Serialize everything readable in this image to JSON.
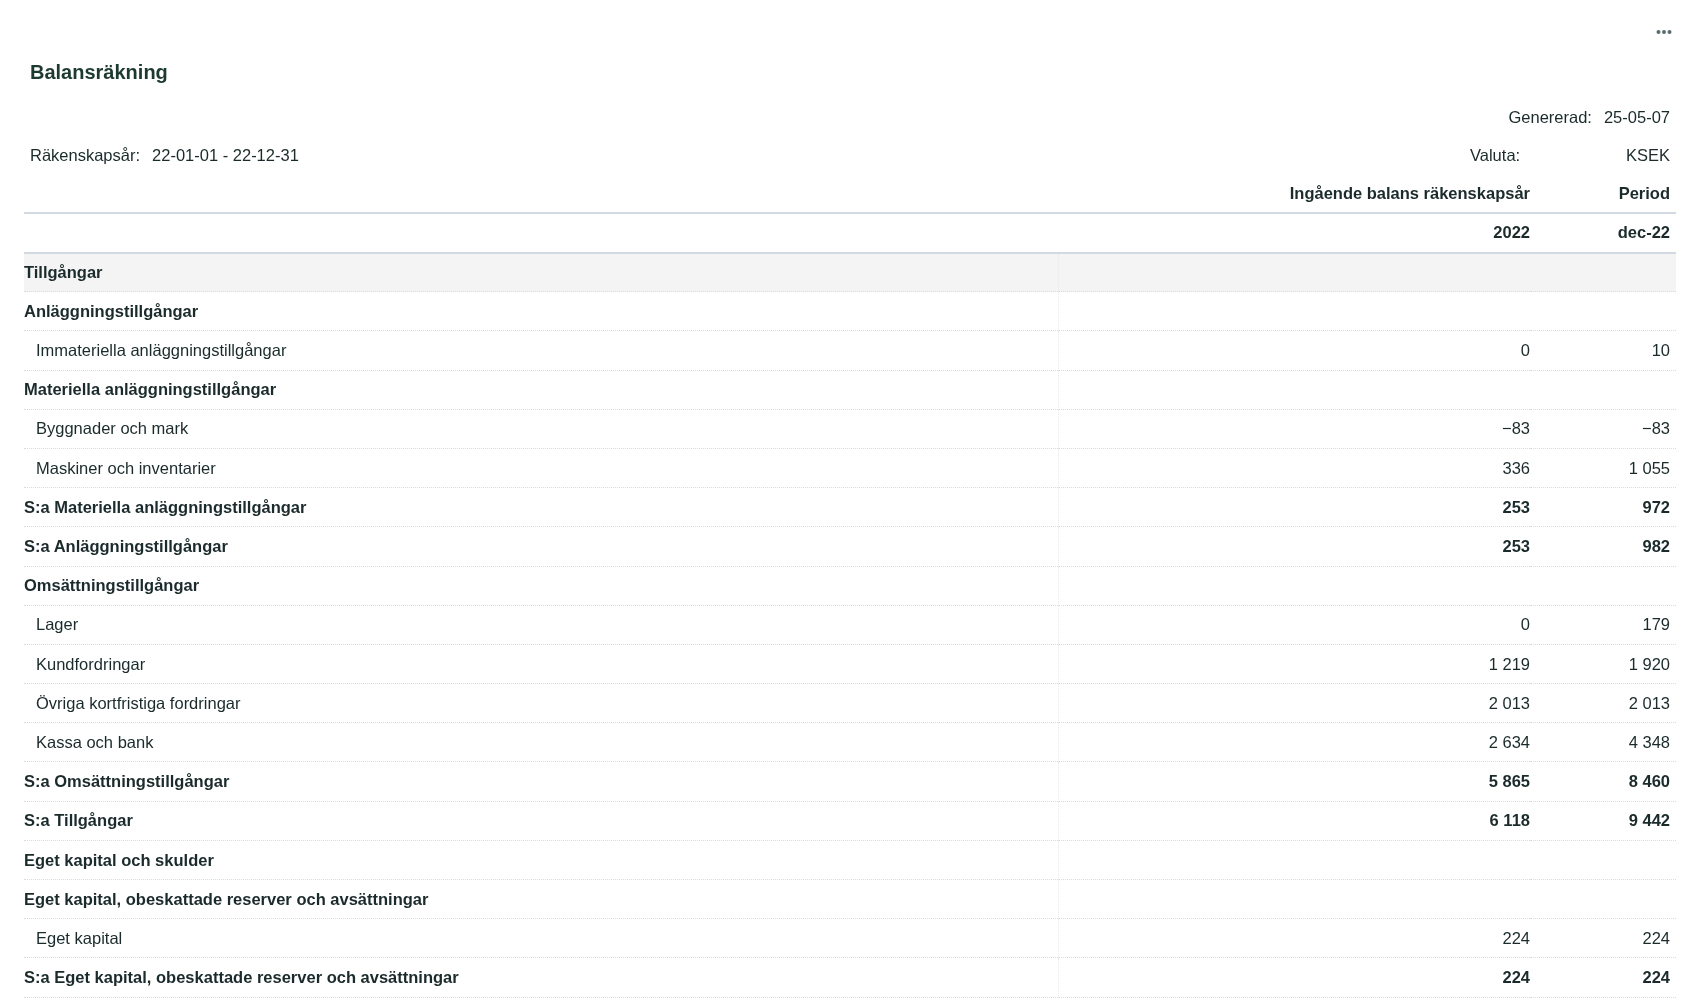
{
  "title": "Balansräkning",
  "generated": {
    "label": "Genererad:",
    "value": "25-05-07"
  },
  "fiscal_year": {
    "label": "Räkenskapsår:",
    "value": "22-01-01 - 22-12-31"
  },
  "currency": {
    "label": "Valuta:",
    "value": "KSEK"
  },
  "columns": [
    {
      "heading": "Ingående balans räkenskapsår",
      "subheading": "2022"
    },
    {
      "heading": "Period",
      "subheading": "dec-22"
    }
  ],
  "rows": [
    {
      "kind": "section",
      "label": "Tillgångar"
    },
    {
      "kind": "heading",
      "label": "Anläggningstillgångar"
    },
    {
      "kind": "item",
      "label": "Immateriella anläggningstillgångar",
      "values": [
        "0",
        "10"
      ]
    },
    {
      "kind": "heading",
      "label": "Materiella anläggningstillgångar"
    },
    {
      "kind": "item",
      "label": "Byggnader och mark",
      "values": [
        "−83",
        "−83"
      ]
    },
    {
      "kind": "item",
      "label": "Maskiner och inventarier",
      "values": [
        "336",
        "1 055"
      ]
    },
    {
      "kind": "sum",
      "label": "S:a Materiella anläggningstillgångar",
      "values": [
        "253",
        "972"
      ]
    },
    {
      "kind": "sum",
      "label": "S:a Anläggningstillgångar",
      "values": [
        "253",
        "982"
      ]
    },
    {
      "kind": "heading",
      "label": "Omsättningstillgångar"
    },
    {
      "kind": "item",
      "label": "Lager",
      "values": [
        "0",
        "179"
      ]
    },
    {
      "kind": "item",
      "label": "Kundfordringar",
      "values": [
        "1 219",
        "1 920"
      ]
    },
    {
      "kind": "item",
      "label": "Övriga kortfristiga fordringar",
      "values": [
        "2 013",
        "2 013"
      ]
    },
    {
      "kind": "item",
      "label": "Kassa och bank",
      "values": [
        "2 634",
        "4 348"
      ]
    },
    {
      "kind": "sum",
      "label": "S:a Omsättningstillgångar",
      "values": [
        "5 865",
        "8 460"
      ]
    },
    {
      "kind": "sum",
      "label": "S:a Tillgångar",
      "values": [
        "6 118",
        "9 442"
      ]
    },
    {
      "kind": "heading",
      "label": "Eget kapital och skulder"
    },
    {
      "kind": "heading",
      "label": "Eget kapital, obeskattade reserver och avsättningar"
    },
    {
      "kind": "item",
      "label": "Eget kapital",
      "values": [
        "224",
        "224"
      ]
    },
    {
      "kind": "sum",
      "label": "S:a Eget kapital, obeskattade reserver och avsättningar",
      "values": [
        "224",
        "224"
      ]
    }
  ]
}
